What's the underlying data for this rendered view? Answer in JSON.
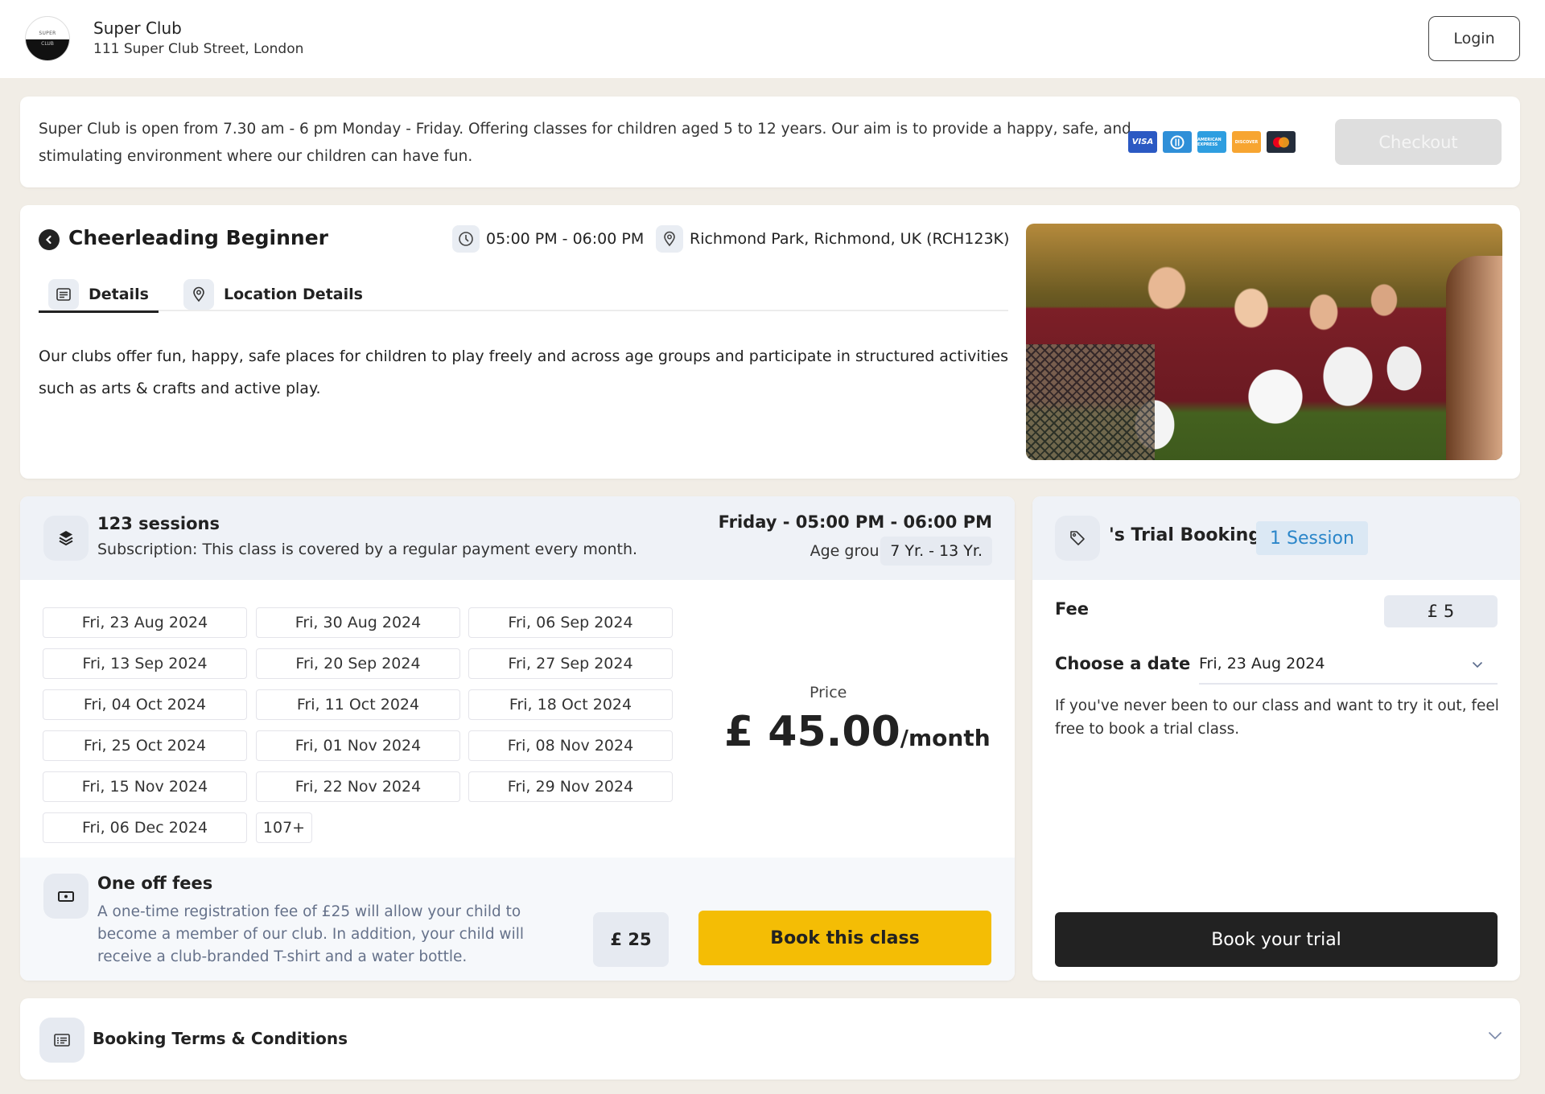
{
  "header": {
    "logo_text_top": "SUPER",
    "logo_text_bottom": "CLUB",
    "club_name": "Super Club",
    "club_address": "111 Super Club Street, London",
    "login_label": "Login"
  },
  "intro": {
    "text": "Super Club is open from 7.30 am - 6 pm Monday - Friday. Offering classes for children aged 5 to 12 years. Our aim is to provide a happy, safe, and stimulating environment where our children can have fun.",
    "payment_methods": [
      {
        "name": "visa-icon",
        "label": "VISA",
        "color": "#2b59c3"
      },
      {
        "name": "diners-club-icon",
        "label": "",
        "color": "#2f8fd8"
      },
      {
        "name": "american-express-icon",
        "label": "AMERICAN EXPRESS",
        "color": "#2e9ee0"
      },
      {
        "name": "discover-icon",
        "label": "DISCOVER",
        "color": "#f7a531"
      },
      {
        "name": "mastercard-icon",
        "label": "",
        "color": "#242d3b"
      }
    ],
    "checkout_label": "Checkout"
  },
  "class": {
    "title": "Cheerleading Beginner",
    "time": "05:00 PM - 06:00 PM",
    "location": "Richmond Park, Richmond, UK (RCH123K)",
    "tabs": [
      {
        "label": "Details",
        "active": true
      },
      {
        "label": "Location Details",
        "active": false
      }
    ],
    "description": "Our clubs offer fun, happy, safe places for children to play freely and across age groups and participate in structured activities such as arts & crafts and active play.",
    "image_alt": "Cheerleaders with white pom-poms in maroon uniforms"
  },
  "sessions": {
    "count_label": "123 sessions",
    "subscription_text": "Subscription: This class is covered by a regular payment every month.",
    "schedule": "Friday - 05:00 PM - 06:00 PM",
    "age_group_label": "Age group:",
    "age_group_value": "7 Yr. - 13 Yr.",
    "dates": [
      "Fri, 23 Aug 2024",
      "Fri, 30 Aug 2024",
      "Fri, 06 Sep 2024",
      "Fri, 13 Sep 2024",
      "Fri, 20 Sep 2024",
      "Fri, 27 Sep 2024",
      "Fri, 04 Oct 2024",
      "Fri, 11 Oct 2024",
      "Fri, 18 Oct 2024",
      "Fri, 25 Oct 2024",
      "Fri, 01 Nov 2024",
      "Fri, 08 Nov 2024",
      "Fri, 15 Nov 2024",
      "Fri, 22 Nov 2024",
      "Fri, 29 Nov 2024",
      "Fri, 06 Dec 2024"
    ],
    "more_label": "107+",
    "price_label": "Price",
    "price_value": "£ 45.00",
    "price_period": "/month",
    "one_off_title": "One off fees",
    "one_off_desc": "A one-time registration fee of £25 will allow your child to become a member of our club. In addition, your child will receive a club-branded T-shirt and a water bottle.",
    "one_off_amount": "£ 25",
    "book_label": "Book this class",
    "book_color": "#f4bd05"
  },
  "trial": {
    "title": "'s Trial Booking",
    "badge": "1 Session",
    "fee_label": "Fee",
    "fee_value": "£ 5",
    "date_label": "Choose a date",
    "selected_date": "Fri, 23 Aug 2024",
    "description": "If you've never been to our class and want to try it out, feel free to book a trial class.",
    "book_label": "Book your trial"
  },
  "terms": {
    "title": "Booking Terms & Conditions"
  }
}
